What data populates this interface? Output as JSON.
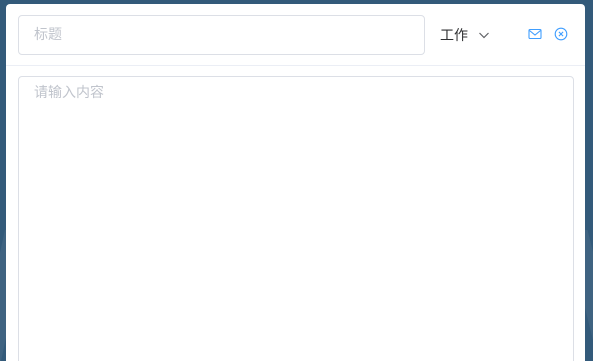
{
  "colors": {
    "backdrop": "#335a7a",
    "accent": "#409eff",
    "border": "#dcdfe6",
    "placeholder": "#c0c4cc",
    "text": "#303133"
  },
  "header": {
    "title_placeholder": "标题",
    "title_value": "",
    "category_selected": "工作",
    "icons": {
      "dropdown": "chevron-down-icon",
      "send": "mail-icon",
      "close": "circle-close-icon"
    }
  },
  "body": {
    "content_placeholder": "请输入内容",
    "content_value": ""
  }
}
